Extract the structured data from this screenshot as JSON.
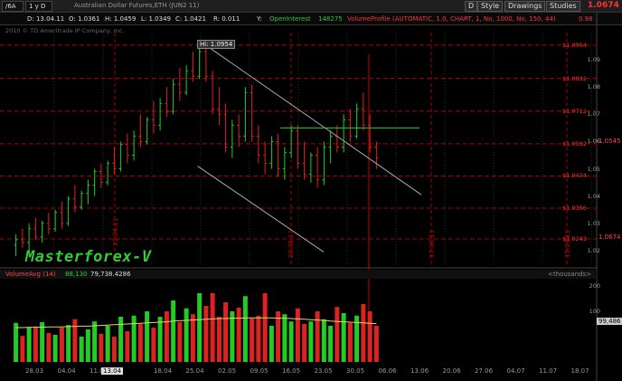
{
  "toolbar": {
    "symbol": "/6A",
    "period": "1 y D",
    "aggregation": "D",
    "style_label": "Style",
    "drawings_label": "Drawings",
    "studies_label": "Studies",
    "last_price": "1.0674"
  },
  "info": {
    "open": "O: 1.0361",
    "date": "D: 13.04.11",
    "high": "H: 1.0459",
    "low": "L: 1.0349",
    "close": "C: 1.0421",
    "range": "R: 0.011",
    "y": "Y:",
    "oi_label": "OpenInterest",
    "oi_value": "148275",
    "vp_label": "VolumeProfile (AUTOMATIC, 1.0, CHART, 1, No, 1000, No, 150, 44)",
    "vp_value": "0.98",
    "title": "Australian Dollar Futures,ETH (JUN2 11)",
    "copyright": "2010 © TD Ameritrade IP Company, Inc."
  },
  "chart": {
    "hi_label": "Hi: 1.0954",
    "y_ticks": [
      "1.09",
      "1.08",
      "1.07",
      "1.06",
      "1.05",
      "1.04",
      "1.03",
      "1.02"
    ],
    "levels": [
      "$1.0954",
      "$1.0832",
      "$1.0712",
      "$1.0592",
      "$1.0474",
      "$1.0356",
      "$1.0243"
    ],
    "side_price_top": "1.0674",
    "side_price_mid": "1.0545",
    "vertical_labels": [
      "13.04.11",
      "20.05.11",
      "17.06.11",
      "15.07.11"
    ],
    "x_ticks": [
      "28.03",
      "04.04",
      "11.04",
      "13.04",
      "18.04",
      "25.04",
      "02.05",
      "09.05",
      "16.05",
      "23.05",
      "30.05",
      "06.06",
      "13.06",
      "20.06",
      "27.06",
      "04.07",
      "11.07",
      "18.07"
    ],
    "x_highlight": "13.04",
    "brand": "Masterforex-V"
  },
  "volume": {
    "title": "VolumeAvg (14)",
    "value1": "88,130",
    "value2": "79,738.4286",
    "units": "<thousands>",
    "y_ticks": [
      "200",
      "100"
    ],
    "side_value": "99,486"
  },
  "chart_data": {
    "type": "bar",
    "title": "Australian Dollar Futures,ETH (JUN2 11)",
    "price_bars": [
      [
        1.022,
        1.026,
        1.018,
        1.024
      ],
      [
        1.024,
        1.028,
        1.021,
        1.023
      ],
      [
        1.023,
        1.03,
        1.02,
        1.028
      ],
      [
        1.028,
        1.032,
        1.024,
        1.025
      ],
      [
        1.025,
        1.031,
        1.023,
        1.03
      ],
      [
        1.03,
        1.034,
        1.026,
        1.028
      ],
      [
        1.028,
        1.035,
        1.027,
        1.034
      ],
      [
        1.034,
        1.038,
        1.028,
        1.03
      ],
      [
        1.03,
        1.04,
        1.029,
        1.039
      ],
      [
        1.039,
        1.044,
        1.034,
        1.036
      ],
      [
        1.036,
        1.042,
        1.035,
        1.041
      ],
      [
        1.041,
        1.046,
        1.037,
        1.044
      ],
      [
        1.044,
        1.05,
        1.04,
        1.049
      ],
      [
        1.049,
        1.052,
        1.043,
        1.045
      ],
      [
        1.045,
        1.053,
        1.044,
        1.052
      ],
      [
        1.052,
        1.058,
        1.048,
        1.05
      ],
      [
        1.05,
        1.06,
        1.049,
        1.059
      ],
      [
        1.059,
        1.063,
        1.052,
        1.055
      ],
      [
        1.055,
        1.064,
        1.053,
        1.062
      ],
      [
        1.062,
        1.07,
        1.058,
        1.06
      ],
      [
        1.06,
        1.069,
        1.059,
        1.068
      ],
      [
        1.068,
        1.075,
        1.063,
        1.066
      ],
      [
        1.066,
        1.076,
        1.064,
        1.074
      ],
      [
        1.074,
        1.08,
        1.069,
        1.071
      ],
      [
        1.071,
        1.083,
        1.07,
        1.081
      ],
      [
        1.081,
        1.087,
        1.075,
        1.078
      ],
      [
        1.078,
        1.088,
        1.077,
        1.086
      ],
      [
        1.086,
        1.093,
        1.082,
        1.084
      ],
      [
        1.084,
        1.095,
        1.083,
        1.093
      ],
      [
        1.093,
        1.095,
        1.082,
        1.084
      ],
      [
        1.084,
        1.086,
        1.07,
        1.072
      ],
      [
        1.072,
        1.08,
        1.066,
        1.07
      ],
      [
        1.07,
        1.074,
        1.056,
        1.058
      ],
      [
        1.058,
        1.068,
        1.054,
        1.066
      ],
      [
        1.066,
        1.07,
        1.058,
        1.062
      ],
      [
        1.062,
        1.08,
        1.06,
        1.078
      ],
      [
        1.078,
        1.081,
        1.06,
        1.062
      ],
      [
        1.062,
        1.066,
        1.052,
        1.055
      ],
      [
        1.055,
        1.06,
        1.048,
        1.052
      ],
      [
        1.052,
        1.062,
        1.05,
        1.06
      ],
      [
        1.06,
        1.063,
        1.047,
        1.05
      ],
      [
        1.05,
        1.058,
        1.046,
        1.056
      ],
      [
        1.056,
        1.066,
        1.054,
        1.064
      ],
      [
        1.064,
        1.066,
        1.05,
        1.052
      ],
      [
        1.052,
        1.06,
        1.046,
        1.048
      ],
      [
        1.048,
        1.056,
        1.045,
        1.055
      ],
      [
        1.055,
        1.058,
        1.043,
        1.046
      ],
      [
        1.046,
        1.06,
        1.044,
        1.058
      ],
      [
        1.058,
        1.064,
        1.052,
        1.062
      ],
      [
        1.062,
        1.066,
        1.056,
        1.058
      ],
      [
        1.058,
        1.07,
        1.056,
        1.068
      ],
      [
        1.068,
        1.072,
        1.06,
        1.062
      ],
      [
        1.062,
        1.074,
        1.061,
        1.072
      ],
      [
        1.072,
        1.078,
        1.064,
        1.066
      ],
      [
        1.066,
        1.07,
        1.056,
        1.058
      ],
      [
        1.058,
        1.06,
        1.05,
        1.054
      ]
    ],
    "volume": [
      108,
      72,
      96,
      98,
      110,
      80,
      75,
      95,
      102,
      118,
      70,
      90,
      112,
      78,
      100,
      70,
      125,
      85,
      128,
      105,
      140,
      95,
      125,
      140,
      170,
      110,
      148,
      132,
      190,
      155,
      190,
      125,
      165,
      140,
      150,
      182,
      120,
      128,
      190,
      100,
      140,
      132,
      112,
      148,
      105,
      112,
      140,
      118,
      100,
      152,
      135,
      108,
      128,
      160,
      140,
      100
    ],
    "volume_avg": [
      95,
      95,
      96,
      96,
      96,
      97,
      97,
      97,
      98,
      98,
      99,
      99,
      100,
      101,
      102,
      103,
      104,
      105,
      106,
      107,
      108,
      109,
      110,
      111,
      113,
      114,
      115,
      116,
      117,
      118,
      119,
      120,
      120,
      121,
      121,
      122,
      122,
      122,
      122,
      122,
      121,
      121,
      120,
      119,
      118,
      117,
      116,
      115,
      113,
      112,
      111,
      110,
      109,
      108,
      107,
      106
    ],
    "ylim": [
      1.015,
      1.1
    ],
    "volume_ylim": [
      0,
      220
    ]
  }
}
